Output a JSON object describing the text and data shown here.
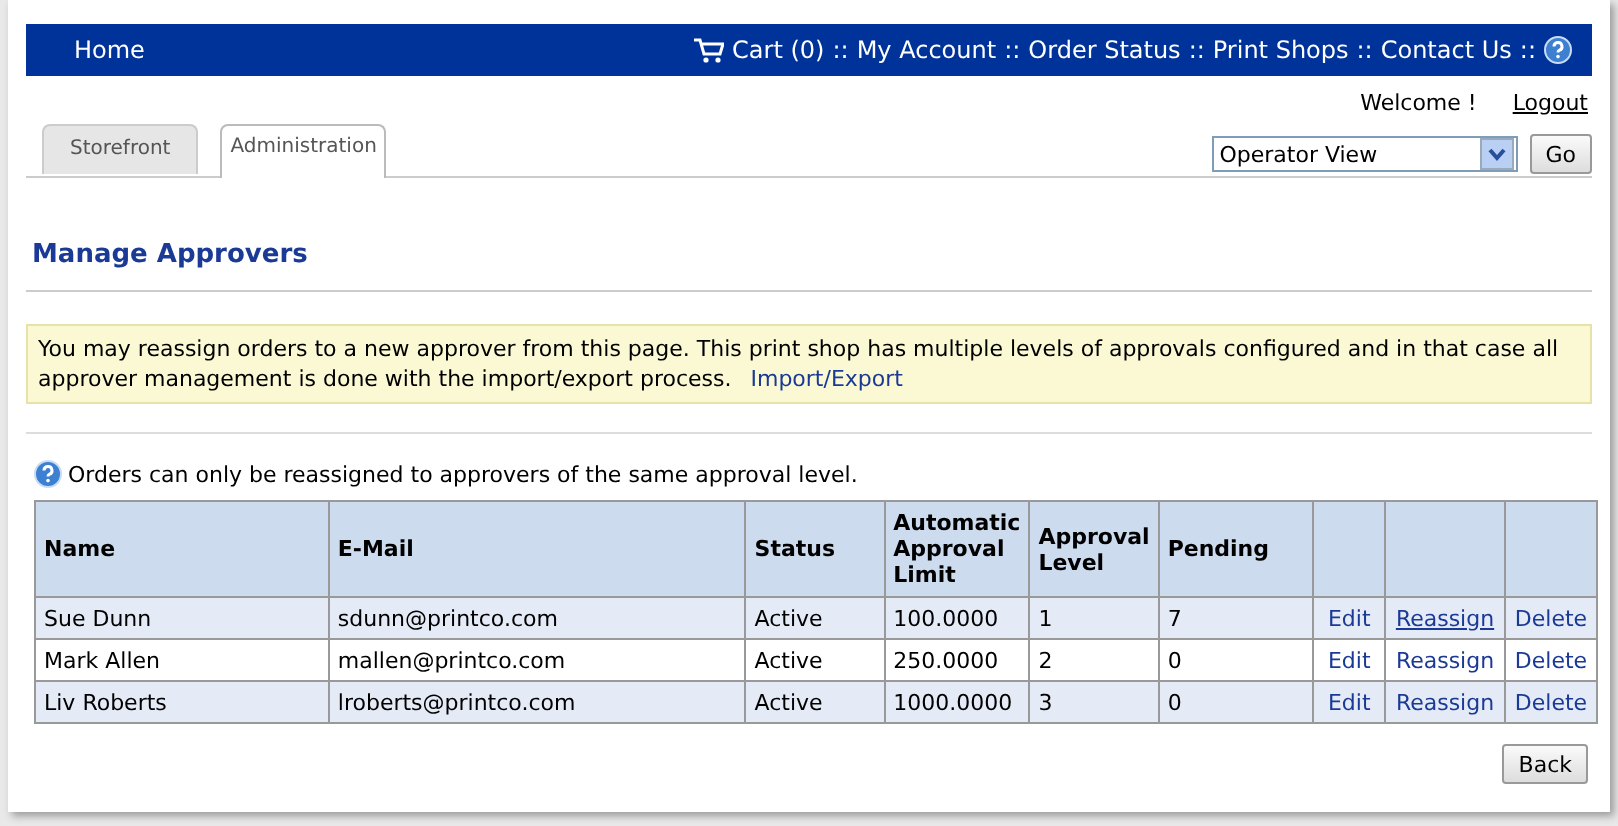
{
  "topbar": {
    "home": "Home",
    "cart": "Cart (0)",
    "links": [
      "My Account",
      "Order Status",
      "Print Shops",
      "Contact Us"
    ],
    "separator": "::"
  },
  "user": {
    "welcome": "Welcome !",
    "logout": "Logout"
  },
  "tabs": [
    {
      "label": "Storefront",
      "selected": false
    },
    {
      "label": "Administration",
      "selected": true
    }
  ],
  "view_select": {
    "value": "Operator View"
  },
  "go_button": "Go",
  "page_title": "Manage Approvers",
  "notice": {
    "text": "You may reassign orders to a new approver from this page. This print shop has multiple levels of approvals configured and in that case all approver management is done with the import/export process.",
    "link": "Import/Export"
  },
  "info": "Orders can only be reassigned to approvers of the same approval level.",
  "table": {
    "columns": [
      "Name",
      "E-Mail",
      "Status",
      "Automatic Approval Limit",
      "Approval Level",
      "Pending"
    ],
    "rows": [
      {
        "cells": [
          "Sue Dunn",
          "sdunn@printco.com",
          "Active",
          "100.0000",
          "1",
          "7"
        ],
        "actions": [
          {
            "label": "Edit",
            "hovered": false
          },
          {
            "label": "Reassign",
            "hovered": true
          },
          {
            "label": "Delete",
            "hovered": false
          }
        ]
      },
      {
        "cells": [
          "Mark Allen",
          "mallen@printco.com",
          "Active",
          "250.0000",
          "2",
          "0"
        ],
        "actions": [
          {
            "label": "Edit",
            "hovered": false
          },
          {
            "label": "Reassign",
            "hovered": false
          },
          {
            "label": "Delete",
            "hovered": false
          }
        ]
      },
      {
        "cells": [
          "Liv Roberts",
          "lroberts@printco.com",
          "Active",
          "1000.0000",
          "3",
          "0"
        ],
        "actions": [
          {
            "label": "Edit",
            "hovered": false
          },
          {
            "label": "Reassign",
            "hovered": false
          },
          {
            "label": "Delete",
            "hovered": false
          }
        ]
      }
    ]
  },
  "back_button": "Back"
}
